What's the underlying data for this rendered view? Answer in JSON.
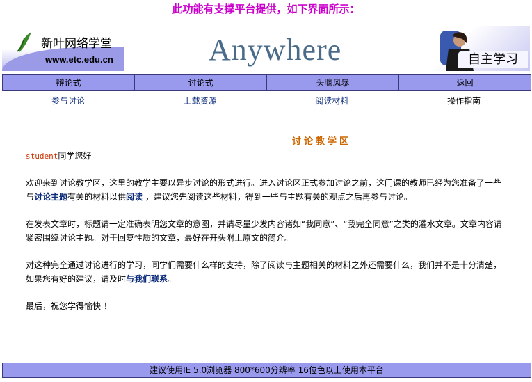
{
  "top_note": "此功能有支撑平台提供，如下界面所示：",
  "banner": {
    "logo_title": "新叶网络学堂",
    "logo_url": "www.etc.edu.cn",
    "center_title": "Anywhere",
    "right_label": "自主学习"
  },
  "nav": {
    "items": [
      "辩论式",
      "讨论式",
      "头脑风暴",
      "返回"
    ]
  },
  "subnav": {
    "items": [
      "参与讨论",
      "上载资源",
      "阅读材料",
      "操作指南"
    ]
  },
  "section_title": "讨论教学区",
  "content": {
    "user": "student",
    "greeting": "同学您好",
    "p1_a": "欢迎来到讨论教学区，这里的教学主要以异步讨论的形式进行。进入讨论区正式参加讨论之前，这门课的教师已经为您准备了一些与",
    "p1_link1": "讨论主题",
    "p1_b": "有关的材料以供",
    "p1_link2": "阅读",
    "p1_c": " ，建议您先阅读这些材料，得到一些与主题有关的观点之后再参与讨论。",
    "p2": "在发表文章时，标题请一定准确表明您文章的意图，并请尽量少发内容诸如“我同意”、“我完全同意”之类的灌水文章。文章内容请紧密围绕讨论主题。对于回复性质的文章，最好在开头附上原文的简介。",
    "p3_a": "对这种完全通过讨论进行的学习，同学们需要什么样的支持，除了阅读与主题相关的材料之外还需要什么，我们并不是十分清楚，如果您有好的建议，请及时",
    "p3_link": "与我们联系",
    "p3_b": "。",
    "p4": "最后，祝您学得愉快 ！"
  },
  "footer": "建议使用IE 5.0浏览器 800*600分辨率 16位色以上使用本平台",
  "colors": {
    "nav_bg": "#9999ee",
    "top_note": "#cc00cc",
    "section_title": "#cc6600",
    "link": "#0a2a7a"
  }
}
